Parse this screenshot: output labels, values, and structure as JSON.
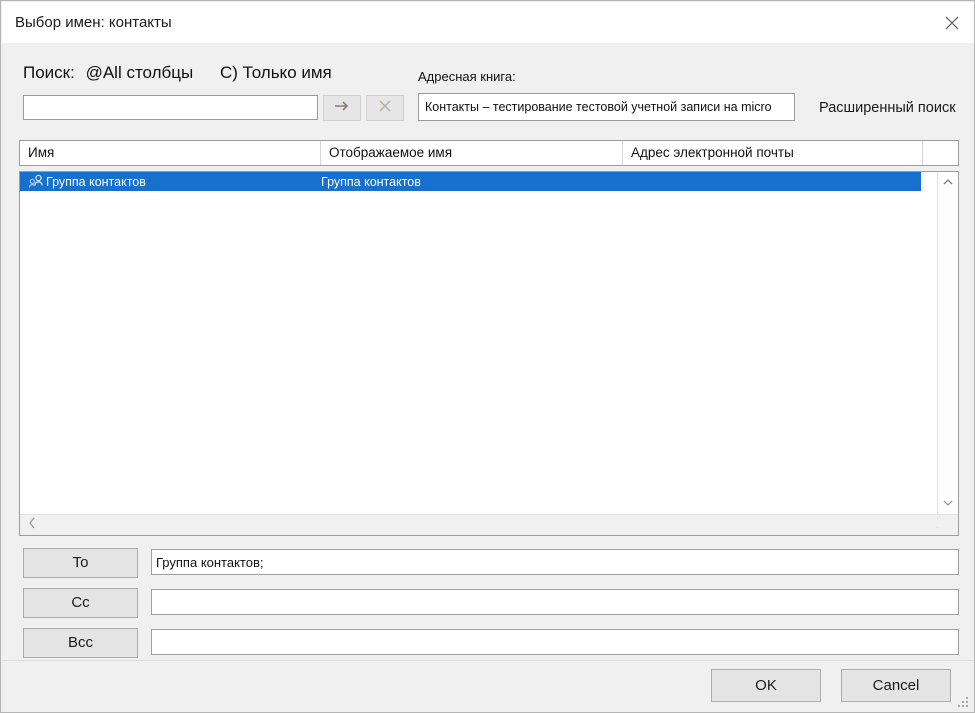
{
  "window": {
    "title": "Выбор имен: контакты",
    "close_icon": "close-icon"
  },
  "search": {
    "label_prefix": "Поиск:",
    "option_all_columns": "@All столбцы",
    "option_name_only": "С) Только имя",
    "input_value": "",
    "input_placeholder": "",
    "go_icon": "arrow-right-icon",
    "clear_icon": "close-icon",
    "advanced_link": "Расширенный поиск"
  },
  "address_book": {
    "label": "Адресная книга:",
    "selected": "Контакты – тестирование тестовой учетной записи на micro"
  },
  "list": {
    "columns": [
      {
        "label": "Имя"
      },
      {
        "label": "Отображаемое имя"
      },
      {
        "label": "Адрес электронной почты"
      },
      {
        "label": ""
      }
    ],
    "rows": [
      {
        "icon": "contact-group-icon",
        "name": "Группа контактов",
        "display_name": "Группа контактов",
        "email": "",
        "selected": true
      }
    ],
    "scroll": {
      "up_icon": "chevron-up-icon",
      "down_icon": "chevron-down-icon",
      "left_icon": "chevron-left-icon",
      "right_icon": "chevron-right-icon"
    }
  },
  "recipients": [
    {
      "button": "To",
      "value": "Группа контактов;"
    },
    {
      "button": "Cc",
      "value": ""
    },
    {
      "button": "Bcc",
      "value": ""
    }
  ],
  "footer": {
    "ok": "OK",
    "cancel": "Cancel"
  },
  "colors": {
    "selection_blue": "#1571cd",
    "dialog_bg": "#f0f0f0",
    "button_face": "#e4e4e4",
    "border": "#9d9d9d"
  }
}
